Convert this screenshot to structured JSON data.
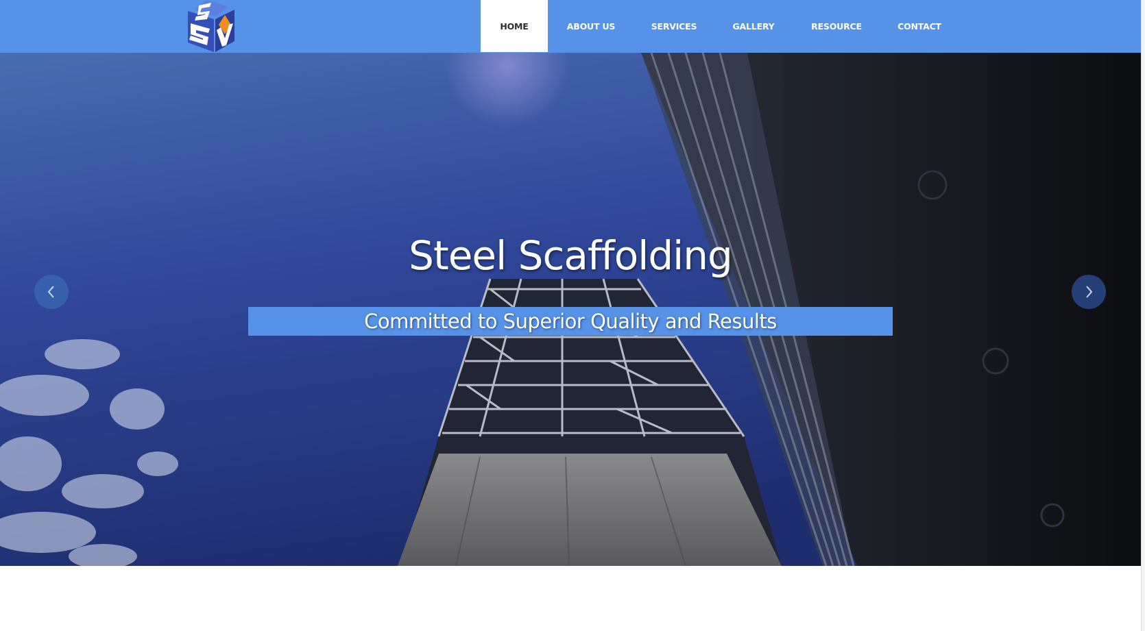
{
  "brand": {
    "logo_letters": "SSV",
    "colors": {
      "header": "#5592e8",
      "active_nav_bg": "#ffffff",
      "logo_orange": "#f28c1c",
      "logo_blue": "#3b5fc9"
    }
  },
  "nav": {
    "items": [
      {
        "label": "HOME",
        "active": true
      },
      {
        "label": "ABOUT US",
        "active": false
      },
      {
        "label": "SERVICES",
        "active": false
      },
      {
        "label": "GALLERY",
        "active": false
      },
      {
        "label": "RESOURCE",
        "active": false
      },
      {
        "label": "CONTACT",
        "active": false
      }
    ]
  },
  "hero": {
    "title": "Steel Scaffolding",
    "subtitle": "Committed to Superior Quality and Results",
    "prev_icon": "chevron-left-icon",
    "next_icon": "chevron-right-icon"
  }
}
